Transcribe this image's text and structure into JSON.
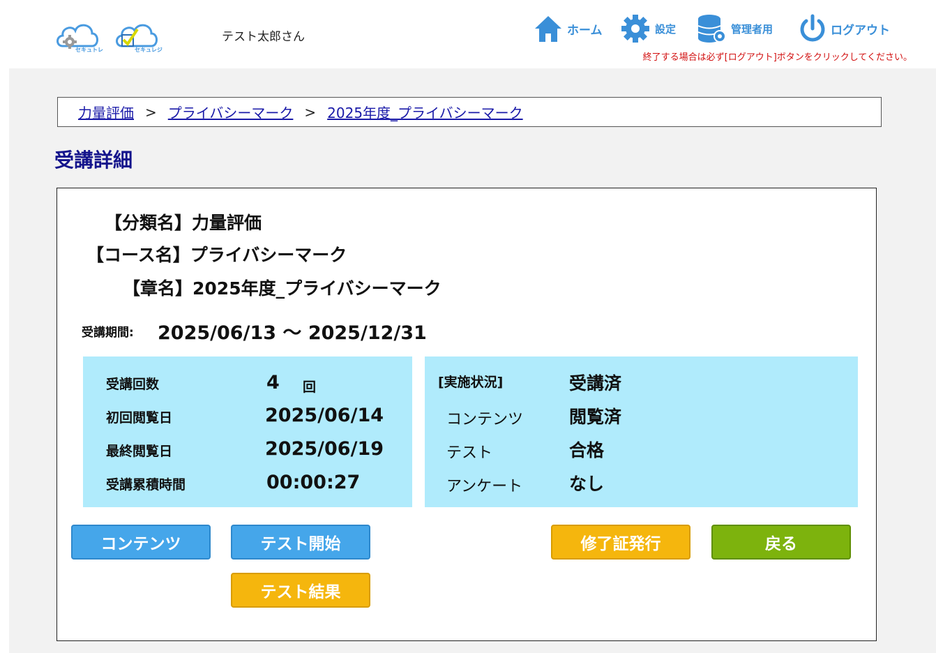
{
  "header": {
    "logos": [
      {
        "name": "sekutore-logo",
        "label": "セキュトレ"
      },
      {
        "name": "sekurereji-logo",
        "label": "セキュレジ"
      }
    ],
    "username": "テスト太郎さん",
    "nav": {
      "home": "ホーム",
      "settings": "設定",
      "admin": "管理者用",
      "logout": "ログアウト"
    },
    "notice": "終了する場合は必ず[ログアウト]ボタンをクリックしてください。"
  },
  "breadcrumb": {
    "items": [
      "力量評価",
      "プライバシーマーク",
      "2025年度_プライバシーマーク"
    ],
    "separator": ">"
  },
  "page_title": "受講詳細",
  "course": {
    "category_label": "【分類名】",
    "category": "力量評価",
    "course_label": "【コース名】",
    "course_name": "プライバシーマーク",
    "chapter_label": "【章名】",
    "chapter": "2025年度_プライバシーマーク",
    "period_label": "受講期間:",
    "period": "2025/06/13 ～ 2025/12/31"
  },
  "stats": {
    "count_label": "受講回数",
    "count": "4",
    "count_unit": "回",
    "first_label": "初回閲覧日",
    "first": "2025/06/14",
    "last_label": "最終閲覧日",
    "last": "2025/06/19",
    "total_label": "受講累積時間",
    "total": "00:00:27"
  },
  "status": {
    "heading_label": "[実施状況]",
    "heading_value": "受講済",
    "contents_label": "コンテンツ",
    "contents_value": "閲覧済",
    "test_label": "テスト",
    "test_value": "合格",
    "survey_label": "アンケート",
    "survey_value": "なし"
  },
  "buttons": {
    "contents": "コンテンツ",
    "test_start": "テスト開始",
    "test_result": "テスト結果",
    "certificate": "修了証発行",
    "back": "戻る"
  },
  "colors": {
    "nav": "#3a8fd8",
    "title": "#14148c",
    "info_box": "#b0ebfc",
    "btn_blue": "#45a6ea",
    "btn_yellow": "#f5b60d",
    "btn_green": "#7db30d",
    "notice": "#d21010"
  }
}
